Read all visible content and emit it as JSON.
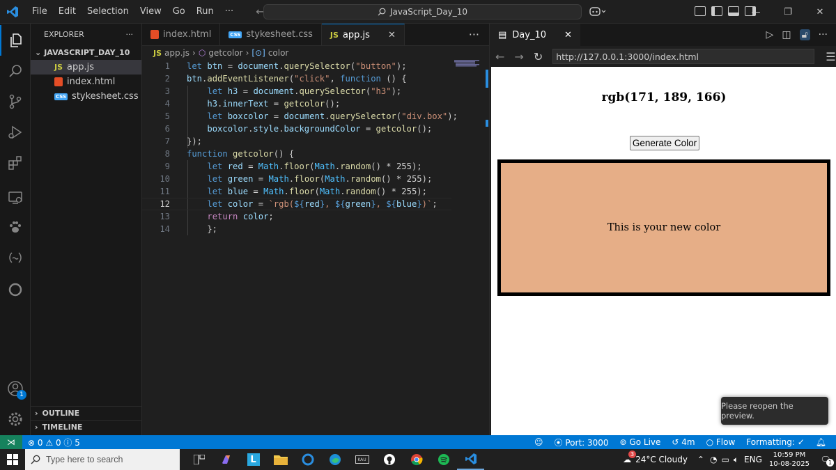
{
  "menu": [
    "File",
    "Edit",
    "Selection",
    "View",
    "Go",
    "Run",
    "···"
  ],
  "command_center": "JavaScript_Day_10",
  "explorer": {
    "title": "EXPLORER",
    "folder": "JAVASCRIPT_DAY_10",
    "files": [
      "app.js",
      "index.html",
      "stykesheet.css"
    ],
    "outline": "OUTLINE",
    "timeline": "TIMELINE",
    "account_badge": "1"
  },
  "tabs": [
    {
      "label": "index.html",
      "icon": "html-icon"
    },
    {
      "label": "stykesheet.css",
      "icon": "css-icon"
    },
    {
      "label": "app.js",
      "icon": "js-icon"
    }
  ],
  "breadcrumb": {
    "file": "app.js",
    "symbol": "getcolor",
    "variable": "color"
  },
  "preview": {
    "tab": "Day_10",
    "url": "http://127.0.0.1:3000/index.html",
    "heading": "rgb(171, 189, 166)",
    "button": "Generate Color",
    "box_text": "This is your new color",
    "box_color": "#e6ae87",
    "toast": "Please reopen the preview."
  },
  "statusbar": {
    "errors": "0",
    "warnings": "0",
    "info": "5",
    "port": "Port: 3000",
    "go_live": "Go Live",
    "time": "4m",
    "flow": "Flow",
    "formatting": "Formatting: ✓"
  },
  "taskbar": {
    "search_placeholder": "Type here to search",
    "weather": "24°C Cloudy",
    "weather_badge": "3",
    "lang": "ENG",
    "time": "10:59 PM",
    "date": "10-08-2025",
    "notif_badge": "1"
  },
  "colors": {
    "accent": "#0078d4",
    "editor_bg": "#1f1f1f",
    "sidebar_bg": "#181818"
  }
}
